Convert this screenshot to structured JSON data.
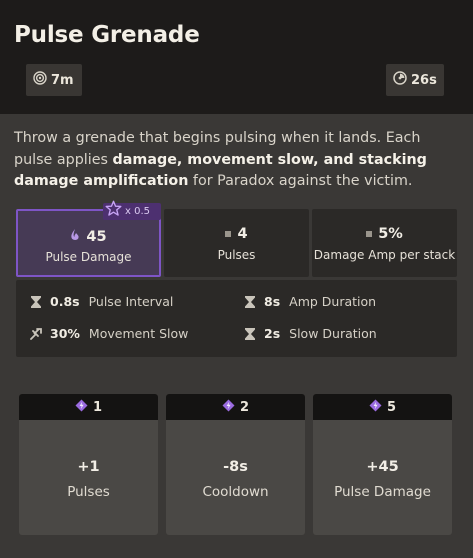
{
  "ability": {
    "title": "Pulse Grenade",
    "range": {
      "value": "7m",
      "icon": "range-target-icon"
    },
    "cooldown": {
      "value": "26s",
      "icon": "cooldown-clock-icon"
    }
  },
  "description": {
    "part1": "Throw a grenade that begins pulsing when it lands. Each pulse applies ",
    "bold": "damage, movement slow, and stacking damage amplification",
    "part2": " for Paradox against the victim."
  },
  "stats": [
    {
      "value": "45",
      "label": "Pulse Damage",
      "icon": "spirit-damage-icon"
    },
    {
      "value": "4",
      "label": "Pulses",
      "icon": "square-bullet-icon"
    },
    {
      "value": "5%",
      "label": "Damage Amp per stack",
      "icon": "square-bullet-icon"
    }
  ],
  "spirit_scaling": {
    "text": "x 0.5",
    "icon": "spirit-power-star-icon"
  },
  "secondary": [
    {
      "value": "0.8s",
      "label": "Pulse Interval",
      "icon": "hourglass-icon"
    },
    {
      "value": "8s",
      "label": "Amp Duration",
      "icon": "hourglass-icon"
    },
    {
      "value": "30%",
      "label": "Movement Slow",
      "icon": "slow-icon"
    },
    {
      "value": "2s",
      "label": "Slow Duration",
      "icon": "hourglass-icon"
    }
  ],
  "upgrades": [
    {
      "tier": "1",
      "value": "+1",
      "label": "Pulses",
      "icon": "ability-point-icon"
    },
    {
      "tier": "2",
      "value": "-8s",
      "label": "Cooldown",
      "icon": "ability-point-icon"
    },
    {
      "tier": "5",
      "value": "+45",
      "label": "Pulse Damage",
      "icon": "ability-point-icon"
    }
  ],
  "colors": {
    "header_bg": "#1d1b1a",
    "panel_bg": "#3a3836",
    "stat_bg": "#2b2927",
    "spirit_accent": "#7e55c6",
    "spirit_fill": "#463a55",
    "tier_bg": "#4a4845"
  }
}
